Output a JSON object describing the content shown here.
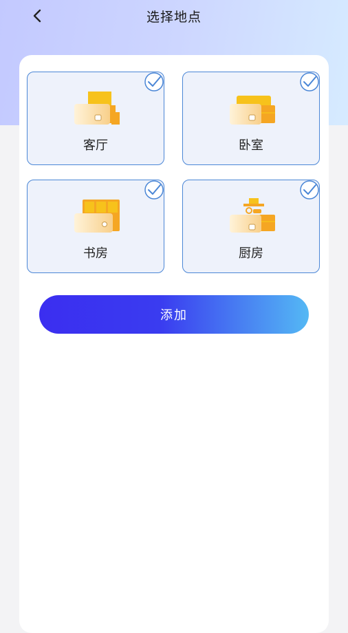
{
  "header": {
    "title": "选择地点",
    "back_icon": "chevron-left-icon"
  },
  "rooms": [
    {
      "label": "客厅",
      "icon": "sofa-icon",
      "selected": true
    },
    {
      "label": "卧室",
      "icon": "bed-icon",
      "selected": true
    },
    {
      "label": "书房",
      "icon": "desk-icon",
      "selected": true
    },
    {
      "label": "厨房",
      "icon": "stove-icon",
      "selected": true
    }
  ],
  "actions": {
    "add_label": "添加"
  },
  "colors": {
    "accent_start": "#3b2ef0",
    "accent_end": "#54b8f4",
    "card_border": "#4a86d6",
    "illustration_yellow": "#f7c21b",
    "illustration_orange": "#f5a623"
  }
}
